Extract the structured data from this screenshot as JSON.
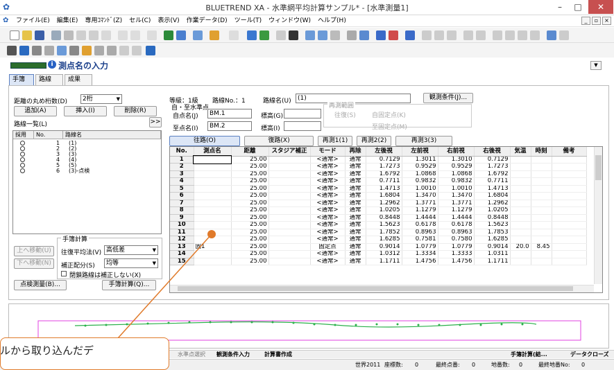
{
  "window": {
    "title": "BLUETREND XA - 水準網平均計算サンプル* - [水準測量1]",
    "min": "–",
    "max": "□",
    "close": "✕"
  },
  "menu": [
    "ファイル(E)",
    "編集(E)",
    "専用ｺﾏﾝﾄﾞ(Z)",
    "セル(C)",
    "表示(V)",
    "作業データ(D)",
    "ツール(T)",
    "ウィンドウ(W)",
    "ヘルプ(H)"
  ],
  "mdi": {
    "min": "_",
    "restore": "▫",
    "close": "×"
  },
  "header": {
    "title": "測点名の入力",
    "info_icon": "i"
  },
  "tabs": [
    "手簿",
    "路線",
    "成果"
  ],
  "left": {
    "rounding_label": "距離の丸め桁数(D)",
    "rounding_value": "2桁",
    "add": "追加(A)",
    "insert": "挿入(I)",
    "delete": "削除(R)",
    "list_label": "路線一覧(L)",
    "expand": ">>",
    "list_headers": [
      "採用",
      "No.",
      "路線名"
    ],
    "routes": [
      {
        "no": "1",
        "name": "(1)"
      },
      {
        "no": "2",
        "name": "(2)"
      },
      {
        "no": "3",
        "name": "(3)"
      },
      {
        "no": "4",
        "name": "(4)"
      },
      {
        "no": "5",
        "name": "(5)"
      },
      {
        "no": "6",
        "name": "(3)-点検"
      }
    ],
    "move_up": "上へ移動(U)",
    "move_down": "下へ移動(N)",
    "tehai_group": "手簿計算",
    "ohuku_label": "往復平均法(V)",
    "ohuku_value": "高低差",
    "hosei_label": "補正配分(S)",
    "hosei_value": "均等",
    "kaisa_check": "閉鎖路線は補正しない(X)",
    "check_btn": "点検測量(B)...",
    "calc_btn": "手簿計算(Q)..."
  },
  "top": {
    "grade": "等級：1級",
    "route_no": "路線No.：1",
    "route_name_label": "路線名(U)",
    "route_name_value": "(1)",
    "obs_btn": "観測条件(J)...",
    "ji_group": "自・至水準点",
    "ji_label": "自点名(J)",
    "ji_value": "BM.1",
    "ji_h_label": "標高(G)",
    "ji_h_value": "",
    "shi_label": "至点名(I)",
    "shi_value": "BM.2",
    "shi_h_label": "標高(I)",
    "shi_h_value": "",
    "resurvey_group": "再測範囲",
    "resurvey_ohuku": "往復(S)",
    "resurvey_auto1": "自固定点(K)",
    "resurvey_auto2": "至固定点(M)"
  },
  "subtabs": [
    "往路(O)",
    "復路(X)",
    "再測1(1)",
    "再測2(2)",
    "再測3(3)"
  ],
  "grid": {
    "headers": [
      "No.",
      "測点名",
      "距離",
      "スタジア補正",
      "モード",
      "再除",
      "左後視",
      "左前視",
      "右前視",
      "右後視",
      "気温",
      "時刻",
      "備考"
    ],
    "rows": [
      [
        "1",
        "",
        "25.00",
        "",
        "<通常>",
        "通常",
        "0.7129",
        "1.3011",
        "1.3010",
        "0.7129",
        "",
        "",
        ""
      ],
      [
        "2",
        "",
        "25.00",
        "",
        "<通常>",
        "通常",
        "1.7273",
        "0.9529",
        "0.9529",
        "1.7273",
        "",
        "",
        ""
      ],
      [
        "3",
        "",
        "25.00",
        "",
        "<通常>",
        "通常",
        "1.6792",
        "1.0868",
        "1.0868",
        "1.6792",
        "",
        "",
        ""
      ],
      [
        "4",
        "",
        "25.00",
        "",
        "<通常>",
        "通常",
        "0.7711",
        "0.9832",
        "0.9832",
        "0.7711",
        "",
        "",
        ""
      ],
      [
        "5",
        "",
        "25.00",
        "",
        "<通常>",
        "通常",
        "1.4713",
        "1.0010",
        "1.0010",
        "1.4713",
        "",
        "",
        ""
      ],
      [
        "6",
        "",
        "25.00",
        "",
        "<通常>",
        "通常",
        "1.6804",
        "1.3470",
        "1.3470",
        "1.6804",
        "",
        "",
        ""
      ],
      [
        "7",
        "",
        "25.00",
        "",
        "<通常>",
        "通常",
        "1.2962",
        "1.3771",
        "1.3771",
        "1.2962",
        "",
        "",
        ""
      ],
      [
        "8",
        "",
        "25.00",
        "",
        "<通常>",
        "通常",
        "1.0205",
        "1.1279",
        "1.1279",
        "1.0205",
        "",
        "",
        ""
      ],
      [
        "9",
        "",
        "25.00",
        "",
        "<通常>",
        "通常",
        "0.8448",
        "1.4444",
        "1.4444",
        "0.8448",
        "",
        "",
        ""
      ],
      [
        "10",
        "",
        "25.00",
        "",
        "<通常>",
        "通常",
        "1.5623",
        "0.6178",
        "0.6178",
        "1.5623",
        "",
        "",
        ""
      ],
      [
        "11",
        "",
        "25.00",
        "",
        "<通常>",
        "通常",
        "1.7852",
        "0.8963",
        "0.8963",
        "1.7853",
        "",
        "",
        ""
      ],
      [
        "12",
        "",
        "25.00",
        "",
        "<通常>",
        "通常",
        "1.6285",
        "0.7581",
        "0.7580",
        "1.6285",
        "",
        "",
        ""
      ],
      [
        "13",
        "固1",
        "25.00",
        "",
        "固定点",
        "通常",
        "0.9014",
        "1.0779",
        "1.0779",
        "0.9014",
        "20.0",
        "8.45",
        ""
      ],
      [
        "14",
        "",
        "25.00",
        "",
        "<通常>",
        "通常",
        "1.0312",
        "1.3334",
        "1.3333",
        "1.0311",
        "",
        "",
        ""
      ],
      [
        "15",
        "",
        "25.00",
        "",
        "<通常>",
        "通常",
        "1.1711",
        "1.4756",
        "1.4756",
        "1.1711",
        "",
        "",
        ""
      ]
    ]
  },
  "status1": {
    "left": "水準点選択",
    "obs": "観測条件入力",
    "calc": "計算書作成",
    "right1": "手簿計算(結...",
    "right2": "データクローズ"
  },
  "status2": {
    "coord": "世界2011",
    "coord_count_label": "座標数:",
    "coord_count": "0",
    "last_label": "最終点番:",
    "last": "0",
    "chiban_label": "地番数:",
    "chiban": "0",
    "last_chiban_label": "最終地番No:",
    "last_chiban": "0"
  },
  "callout": {
    "text": "ルから取り込んだデ"
  },
  "colors": {
    "accent": "#2c6e2c",
    "callout": "#e07a2a",
    "profile_line": "#e040e0",
    "profile_points": "#2ab04a"
  }
}
